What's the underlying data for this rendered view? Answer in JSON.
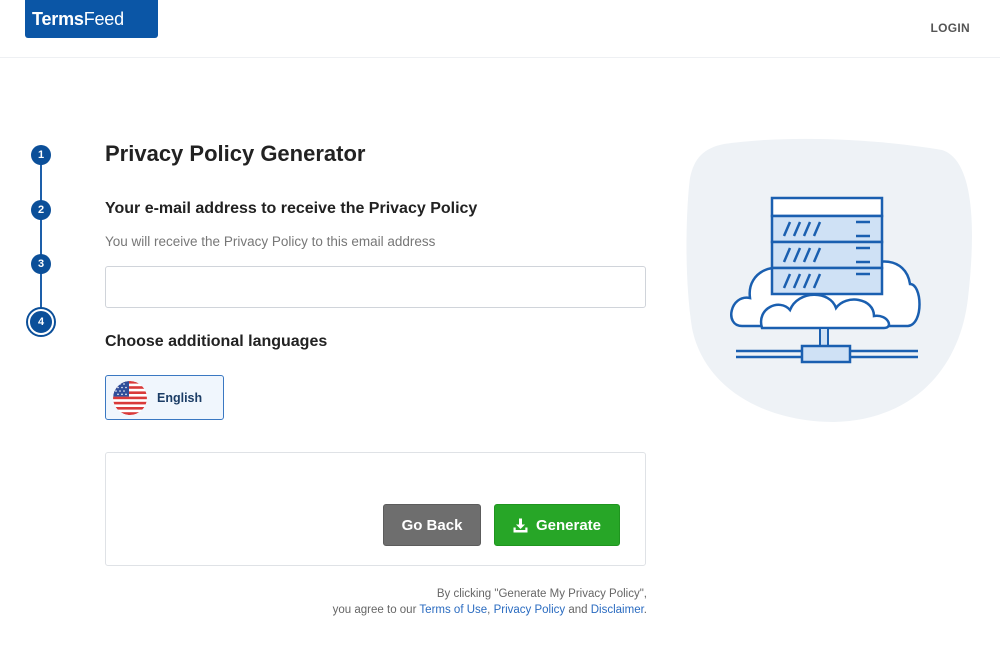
{
  "header": {
    "logo_bold": "Terms",
    "logo_light": "Feed",
    "login_label": "LOGIN"
  },
  "stepper": {
    "steps": [
      "1",
      "2",
      "3",
      "4"
    ],
    "current": 4
  },
  "main": {
    "title": "Privacy Policy Generator",
    "email_section_title": "Your e-mail address to receive the Privacy Policy",
    "email_helper": "You will receive the Privacy Policy to this email address",
    "email_value": "",
    "languages_title": "Choose additional languages",
    "language_button": "English",
    "back_label": "Go Back",
    "generate_label": "Generate"
  },
  "legal": {
    "line1": "By clicking \"Generate My Privacy Policy\",",
    "line2_prefix": "you agree to our",
    "terms_link": "Terms of Use",
    "sep1": ",",
    "privacy_link": "Privacy Policy",
    "and_text": "and",
    "disclaimer_link": "Disclaimer",
    "period": "."
  },
  "colors": {
    "brand_blue": "#0b56a6",
    "step_blue": "#0b4f99",
    "generate_green": "#27a627",
    "back_gray": "#6e6e6e",
    "link_blue": "#2a6bc0"
  },
  "icons": {
    "flag": "us-flag-icon",
    "download": "download-icon",
    "illustration": "cloud-server-illustration"
  }
}
